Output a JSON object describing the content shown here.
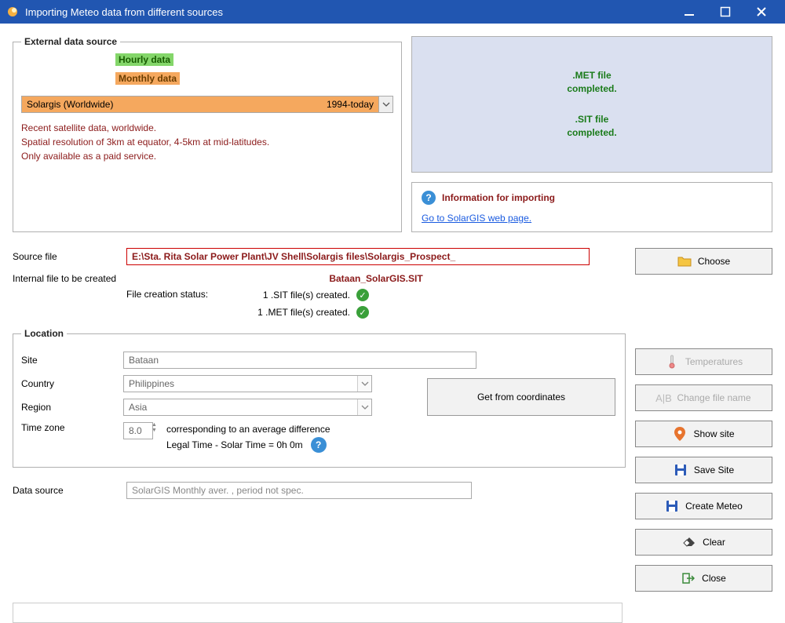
{
  "window": {
    "title": "Importing Meteo data from different sources"
  },
  "external": {
    "legend": "External data source",
    "hourly": "Hourly data",
    "monthly": "Monthly data",
    "provider": "Solargis (Worldwide)",
    "years": "1994-today",
    "desc1": "Recent satellite data, worldwide.",
    "desc2": "Spatial resolution of 3km at equator, 4-5km at mid-latitudes.",
    "desc3": "Only available as a paid service."
  },
  "status": {
    "met1": ".MET file",
    "met2": "completed.",
    "sit1": ".SIT file",
    "sit2": "completed."
  },
  "info": {
    "title": "Information for importing",
    "link": "Go to SolarGIS web page."
  },
  "source": {
    "label": "Source file",
    "path": "E:\\Sta. Rita Solar Power Plant\\JV Shell\\Solargis files\\Solargis_Prospect_",
    "internal_label": "Internal file to be created",
    "status_label": "File creation status:",
    "sit_name": "Bataan_SolarGIS.SIT",
    "sit_created": "1 .SIT file(s) created.",
    "met_created": "1 .MET file(s) created."
  },
  "location": {
    "legend": "Location",
    "site_label": "Site",
    "site": "Bataan",
    "country_label": "Country",
    "country": "Philippines",
    "region_label": "Region",
    "region": "Asia",
    "tz_label": "Time zone",
    "tz": "8.0",
    "tz_text1": "corresponding to an average difference",
    "tz_text2": "Legal Time - Solar Time =  0h  0m",
    "get_coords": "Get from coordinates"
  },
  "datasource": {
    "label": "Data source",
    "value": "SolarGIS Monthly aver. , period not spec."
  },
  "buttons": {
    "choose": "Choose",
    "temperatures": "Temperatures",
    "change_name": "Change file name",
    "show_site": "Show site",
    "save_site": "Save Site",
    "create_meteo": "Create Meteo",
    "clear": "Clear",
    "close": "Close"
  }
}
